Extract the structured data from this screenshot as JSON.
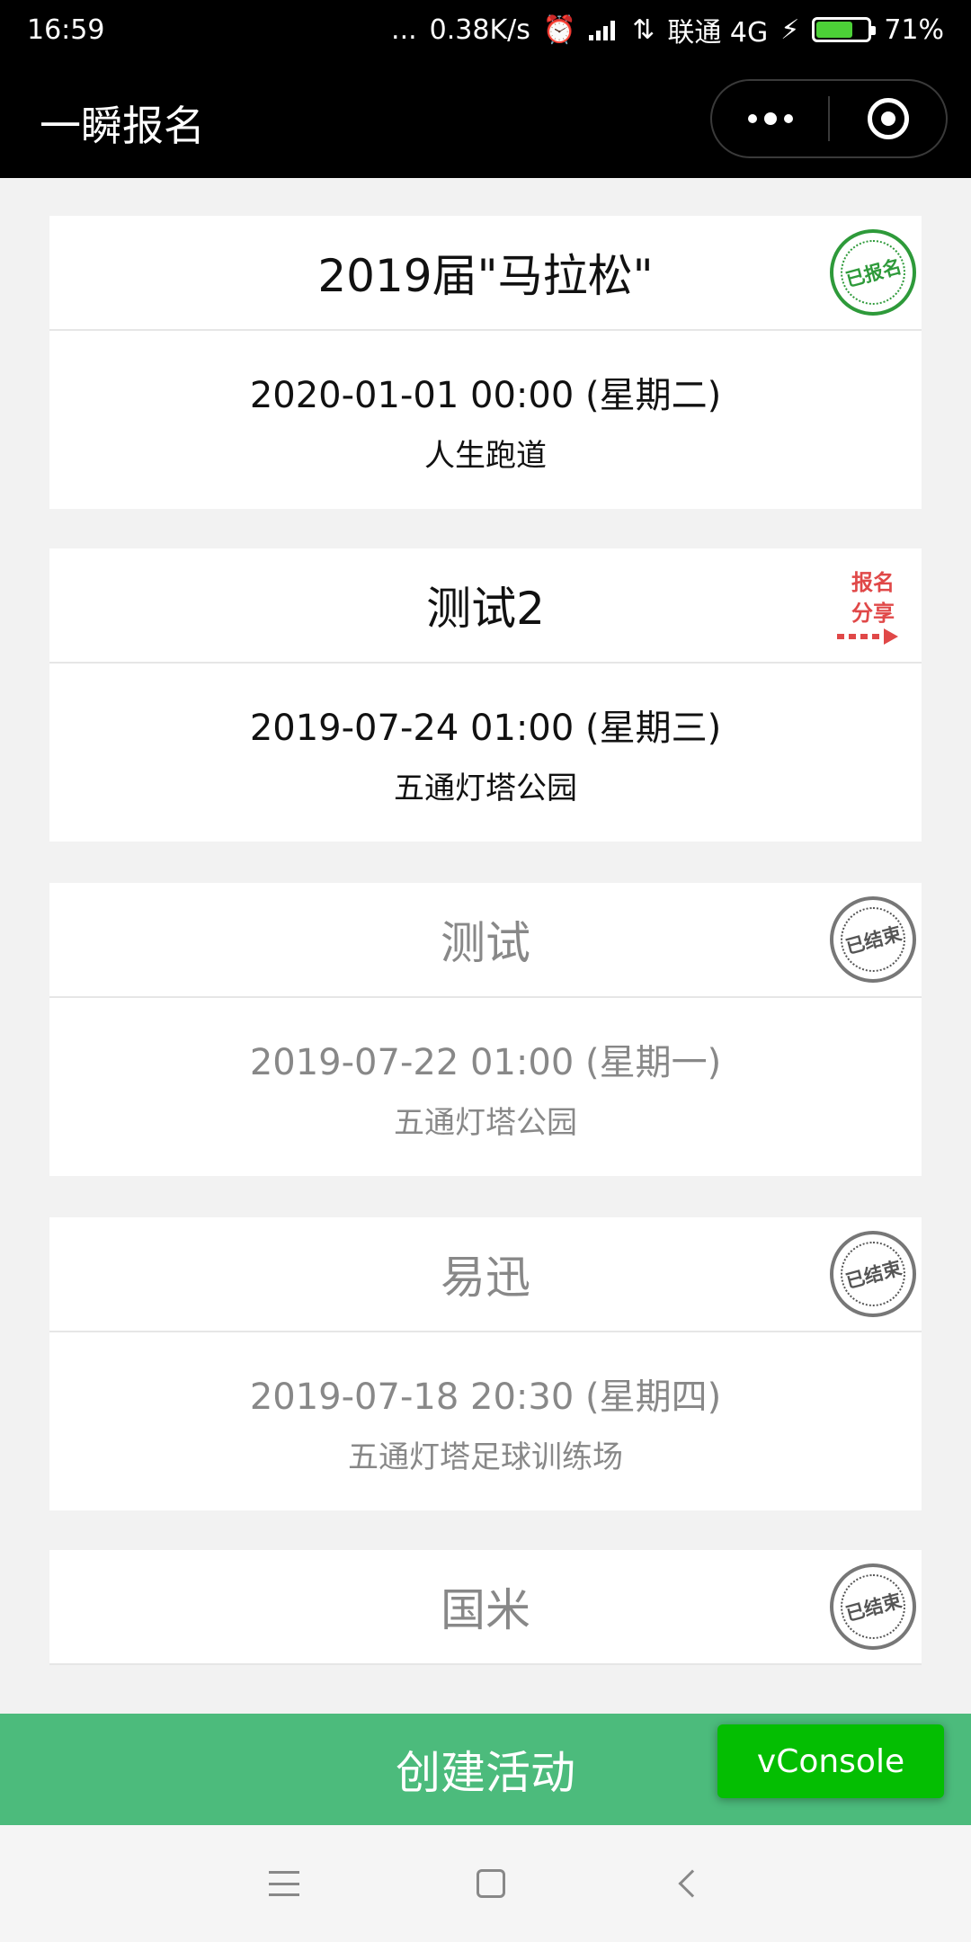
{
  "status": {
    "time": "16:59",
    "dots": "...",
    "speed": "0.38K/s",
    "carrier": "联通 4G",
    "battery": "71%",
    "battery_level": 0.71
  },
  "nav": {
    "title": "一瞬报名"
  },
  "events": [
    {
      "title": "2019届\"马拉松\"",
      "date": "2020-01-01 00:00 (星期二)",
      "place": "人生跑道",
      "badge": "已报名",
      "badge_color": "#2e9a3a"
    },
    {
      "title": "测试2",
      "date": "2019-07-24 01:00 (星期三)",
      "place": "五通灯塔公园",
      "badge_line1": "报名",
      "badge_line2": "分享",
      "badge_color": "#e04848"
    },
    {
      "title": "测试",
      "date": "2019-07-22 01:00 (星期一)",
      "place": "五通灯塔公园",
      "badge": "已结束"
    },
    {
      "title": "易迅",
      "date": "2019-07-18 20:30 (星期四)",
      "place": "五通灯塔足球训练场",
      "badge": "已结束"
    },
    {
      "title": "国米",
      "badge": "已结束"
    }
  ],
  "create_button": "创建活动",
  "vconsole": "vConsole",
  "accent_color": "#4cbb7c"
}
